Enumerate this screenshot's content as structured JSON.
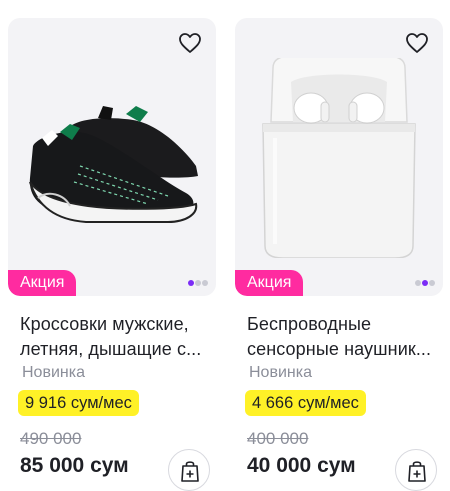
{
  "products": [
    {
      "title_line1": "Кроссовки мужские,",
      "title_line2": "летняя, дышащие с...",
      "badge": "Акция",
      "tag": "Новинка",
      "installment": "9 916 сум/мес",
      "old_price": "490 000",
      "price": "85 000 сум",
      "icons": {
        "favorite": "heart-outline-icon",
        "cart": "shopping-bag-plus-icon"
      }
    },
    {
      "title_line1": "Беспроводные",
      "title_line2": "сенсорные наушник...",
      "badge": "Акция",
      "tag": "Новинка",
      "installment": "4 666 сум/мес",
      "old_price": "400 000",
      "price": "40 000 сум",
      "icons": {
        "favorite": "heart-outline-icon",
        "cart": "shopping-bag-plus-icon"
      }
    }
  ],
  "colors": {
    "badge": "#ff2ba0",
    "installment_bg": "#fff127",
    "active_dot": "#7b2cf6",
    "card_bg": "#f3f3f6",
    "muted_text": "#8b8e99"
  }
}
